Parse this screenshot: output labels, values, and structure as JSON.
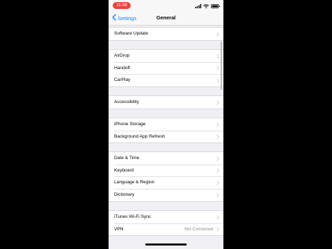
{
  "status_bar": {
    "time": "11:08",
    "icons": [
      "cellular-signal-icon",
      "wifi-icon",
      "battery-icon"
    ]
  },
  "nav": {
    "back_label": "Settings",
    "title": "General"
  },
  "groups": [
    {
      "rows": [
        {
          "label": "Software Update"
        }
      ]
    },
    {
      "rows": [
        {
          "label": "AirDrop"
        },
        {
          "label": "Handoff"
        },
        {
          "label": "CarPlay"
        }
      ]
    },
    {
      "rows": [
        {
          "label": "Accessibility"
        }
      ]
    },
    {
      "rows": [
        {
          "label": "iPhone Storage"
        },
        {
          "label": "Background App Refresh"
        }
      ]
    },
    {
      "rows": [
        {
          "label": "Date & Time"
        },
        {
          "label": "Keyboard"
        },
        {
          "label": "Language & Region"
        },
        {
          "label": "Dictionary"
        }
      ]
    },
    {
      "rows": [
        {
          "label": "iTunes Wi-Fi Sync"
        },
        {
          "label": "VPN",
          "detail": "Not Connected"
        }
      ]
    }
  ],
  "colors": {
    "accent": "#147efb",
    "background": "#efeff4",
    "status_time_pill": "#e8453c",
    "detail_text": "#8e8e93",
    "chevron": "#c7c7cc"
  }
}
